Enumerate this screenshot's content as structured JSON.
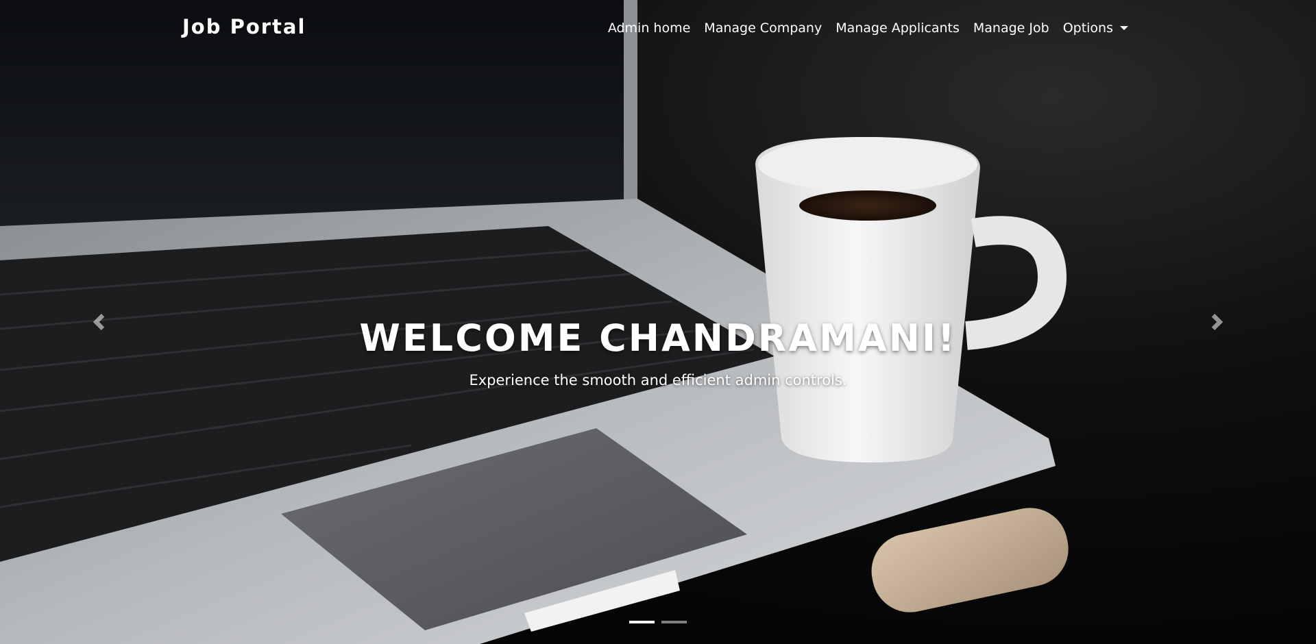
{
  "navbar": {
    "brand": "Job Portal",
    "links": [
      {
        "label": "Admin home"
      },
      {
        "label": "Manage Company"
      },
      {
        "label": "Manage Applicants"
      },
      {
        "label": "Manage Job"
      },
      {
        "label": "Options"
      }
    ]
  },
  "carousel": {
    "title": "WELCOME CHANDRAMANI!",
    "subtitle": "Experience the smooth and efficient admin controls.",
    "active_slide": 1,
    "slide_count": 2
  },
  "icons": {
    "prev": "chevron-left-icon",
    "next": "chevron-right-icon",
    "dropdown": "caret-down-icon"
  },
  "colors": {
    "text": "#ffffff",
    "background": "#050505"
  }
}
